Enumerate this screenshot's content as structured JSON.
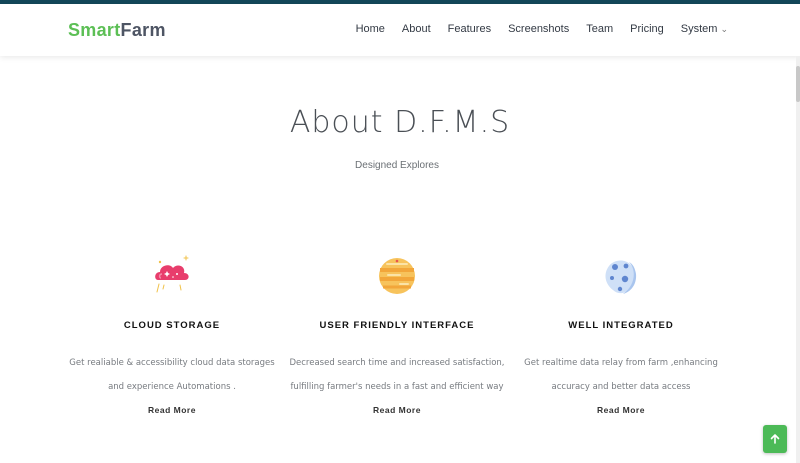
{
  "brand": {
    "part1": "Smart",
    "part2": "Farm"
  },
  "nav": {
    "home": "Home",
    "about": "About",
    "features": "Features",
    "screenshots": "Screenshots",
    "team": "Team",
    "pricing": "Pricing",
    "system": "System",
    "system_icon": "chevron-down-icon"
  },
  "about": {
    "title": "About D.F.M.S",
    "subtitle": "Designed Explores"
  },
  "features": [
    {
      "title": "CLOUD STORAGE",
      "desc_line1": "Get realiable & accessibility cloud data storages",
      "desc_line2": "and experience Automations .",
      "link": "Read More",
      "icon": "cloud-icon",
      "color": "#e83d6c"
    },
    {
      "title": "USER FRIENDLY INTERFACE",
      "desc_line1": "Decreased search time and increased satisfaction,",
      "desc_line2": "fulfilling farmer's needs in a fast and efficient way",
      "link": "Read More",
      "icon": "planet-icon",
      "color": "#f4b03e"
    },
    {
      "title": "WELL INTEGRATED",
      "desc_line1": "Get realtime data relay from farm ,enhancing",
      "desc_line2": "accuracy and better data access",
      "link": "Read More",
      "icon": "moon-icon",
      "color": "#8fb2e6"
    }
  ],
  "back_to_top": {
    "icon": "arrow-up-icon",
    "color": "#4cba57"
  },
  "colors": {
    "top_strip": "#13485a",
    "brand_green": "#5cbf55",
    "brand_gray": "#4e5564"
  }
}
